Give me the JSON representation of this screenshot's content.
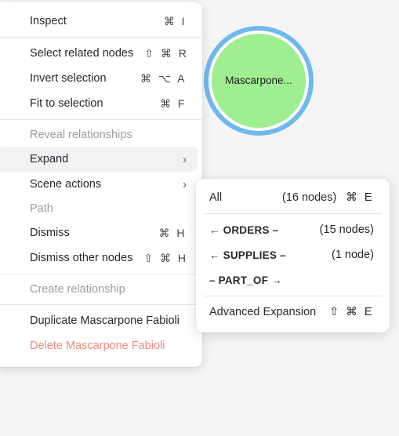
{
  "canvas": {
    "background_color": "#f5f5f5",
    "node": {
      "label": "Mascarpone...",
      "fill_color": "#9fee92",
      "selection_ring_color": "#6fb9ec",
      "inner_ring_color": "#ffffff"
    }
  },
  "context_menu": {
    "groups": [
      {
        "name": "inspect-group",
        "items": [
          {
            "label": "Inspect",
            "shortcut": "⌘ I",
            "kind": "item"
          }
        ]
      },
      {
        "name": "selection-group",
        "items": [
          {
            "label": "Select related nodes",
            "shortcut": "⇧ ⌘ R",
            "kind": "item"
          },
          {
            "label": "Invert selection",
            "shortcut": "⌘ ⌥ A",
            "kind": "item"
          },
          {
            "label": "Fit to selection",
            "shortcut": "⌘ F",
            "kind": "item"
          }
        ]
      },
      {
        "name": "relationships-group",
        "items": [
          {
            "label": "Reveal relationships",
            "kind": "header"
          },
          {
            "label": "Expand",
            "kind": "submenu",
            "chevron": "›",
            "highlighted": true
          },
          {
            "label": "Scene actions",
            "kind": "submenu",
            "chevron": "›",
            "highlighted": false
          },
          {
            "label": "Path",
            "kind": "header"
          },
          {
            "label": "Dismiss",
            "shortcut": "⌘ H",
            "kind": "item"
          },
          {
            "label": "Dismiss other nodes",
            "shortcut": "⇧ ⌘ H",
            "kind": "item"
          }
        ]
      },
      {
        "name": "create-group",
        "items": [
          {
            "label": "Create relationship",
            "kind": "header"
          }
        ]
      },
      {
        "name": "node-actions-group",
        "items": [
          {
            "label": "Duplicate Mascarpone Fabioli",
            "kind": "item"
          },
          {
            "label": "Delete Mascarpone Fabioli",
            "kind": "danger",
            "color": "#f08a7e"
          }
        ]
      }
    ]
  },
  "submenu": {
    "title": "Expand",
    "groups": [
      {
        "name": "expand-all-group",
        "items": [
          {
            "label": "All",
            "count": "(16 nodes)",
            "shortcut": "⌘ E",
            "kind": "item"
          }
        ]
      },
      {
        "name": "expand-relationships-group",
        "items": [
          {
            "label": "← ORDERS –",
            "count": "(15 nodes)",
            "kind": "relationship"
          },
          {
            "label": "← SUPPLIES –",
            "count": "(1 node)",
            "kind": "relationship"
          },
          {
            "label": "– PART_OF →",
            "count": "",
            "kind": "relationship"
          }
        ]
      },
      {
        "name": "advanced-group",
        "items": [
          {
            "label": "Advanced Expansion",
            "shortcut": "⇧ ⌘ E",
            "kind": "item"
          }
        ]
      }
    ]
  }
}
